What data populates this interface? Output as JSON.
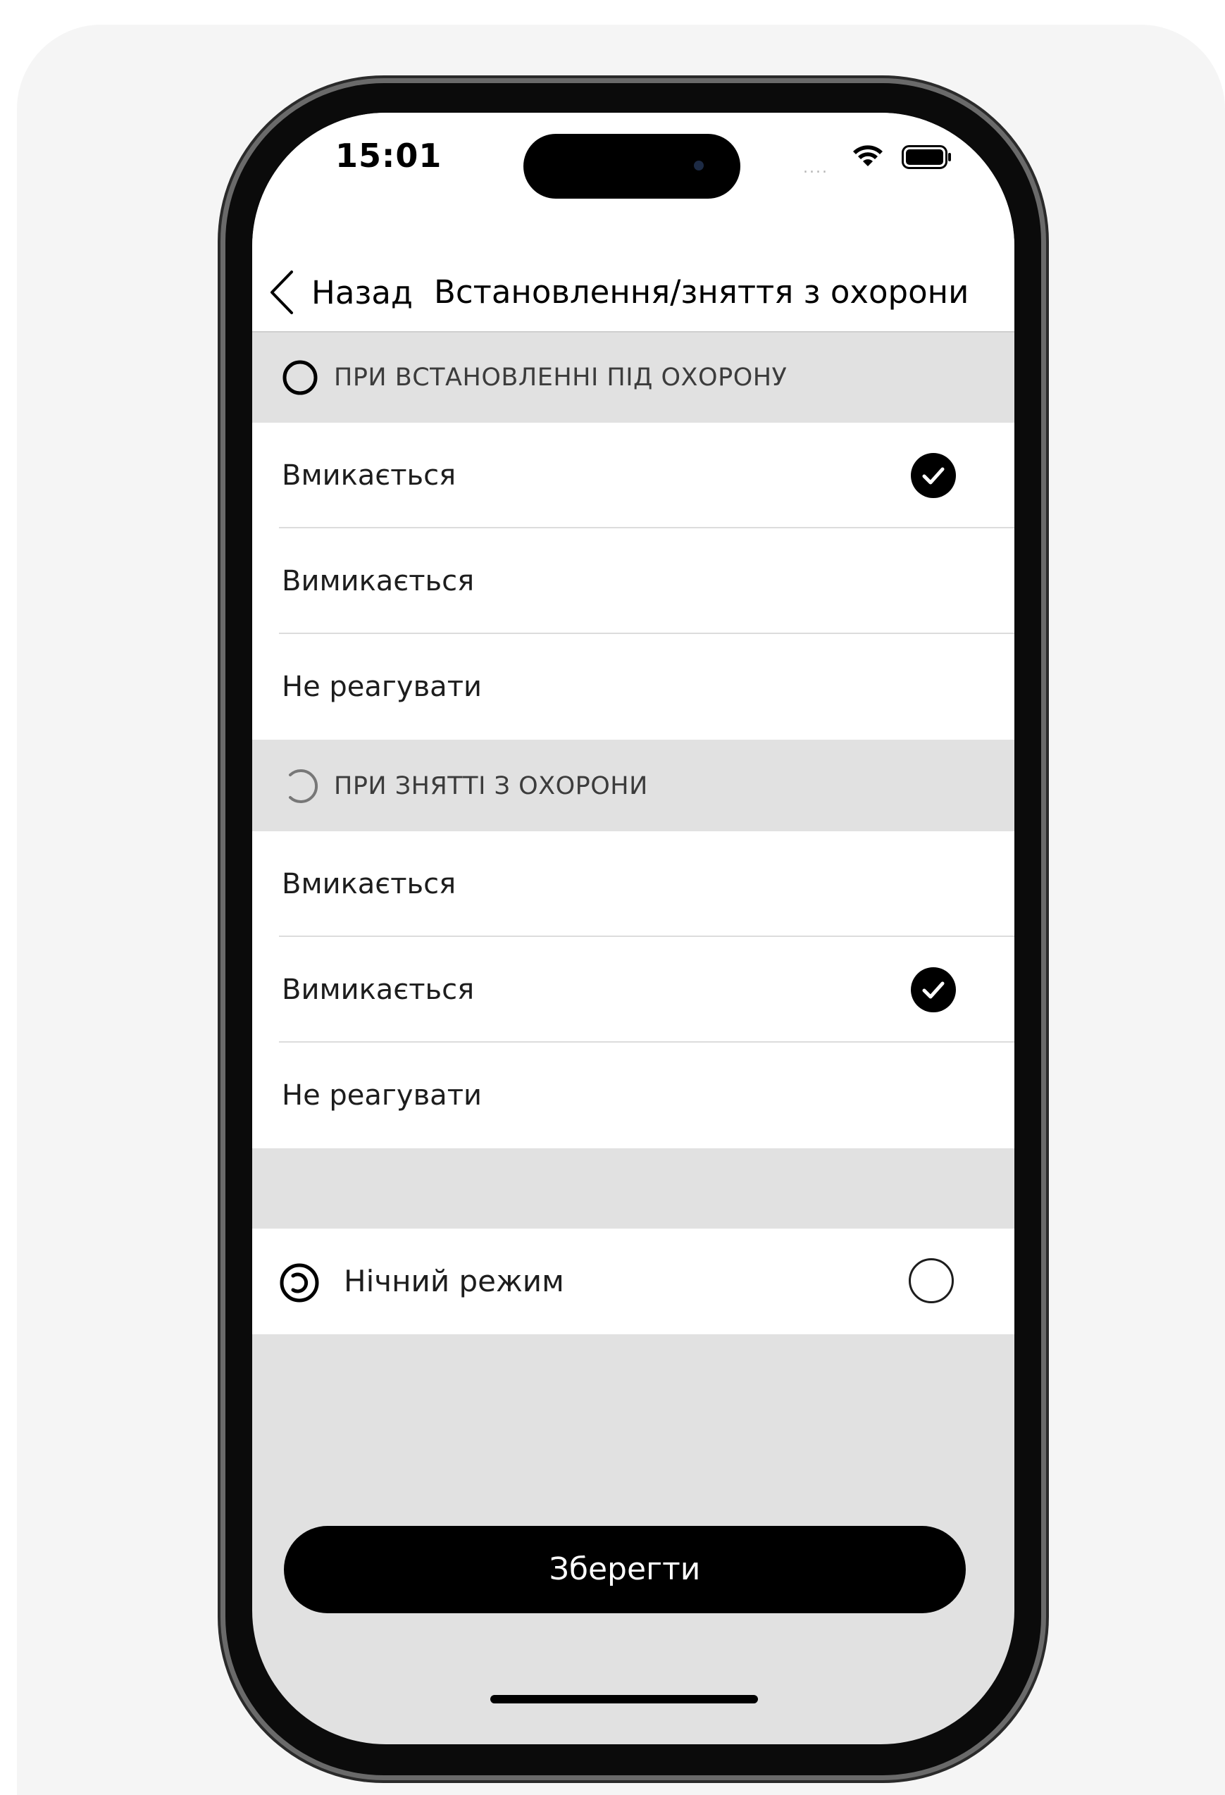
{
  "status_bar": {
    "time": "15:01",
    "signal": "....",
    "icons": [
      "wifi-icon",
      "battery-icon"
    ]
  },
  "nav": {
    "back_label": "Назад",
    "title": "Встановлення/зняття з охорони"
  },
  "sections": [
    {
      "header": "ПРИ ВСТАНОВЛЕННІ ПІД ОХОРОНУ",
      "icon": "armed-ring-icon",
      "options": [
        {
          "label": "Вмикається",
          "selected": true
        },
        {
          "label": "Вимикається",
          "selected": false
        },
        {
          "label": "Не реагувати",
          "selected": false
        }
      ]
    },
    {
      "header": "ПРИ ЗНЯТТІ З ОХОРОНИ",
      "icon": "disarmed-arc-icon",
      "options": [
        {
          "label": "Вмикається",
          "selected": false
        },
        {
          "label": "Вимикається",
          "selected": true
        },
        {
          "label": "Не реагувати",
          "selected": false
        }
      ]
    }
  ],
  "night_mode": {
    "label": "Нічний режим",
    "icon": "night-mode-icon",
    "enabled": false
  },
  "save_button": {
    "label": "Зберегти"
  },
  "colors": {
    "background": "#e1e1e1",
    "row": "#ffffff",
    "accent": "#000000"
  }
}
